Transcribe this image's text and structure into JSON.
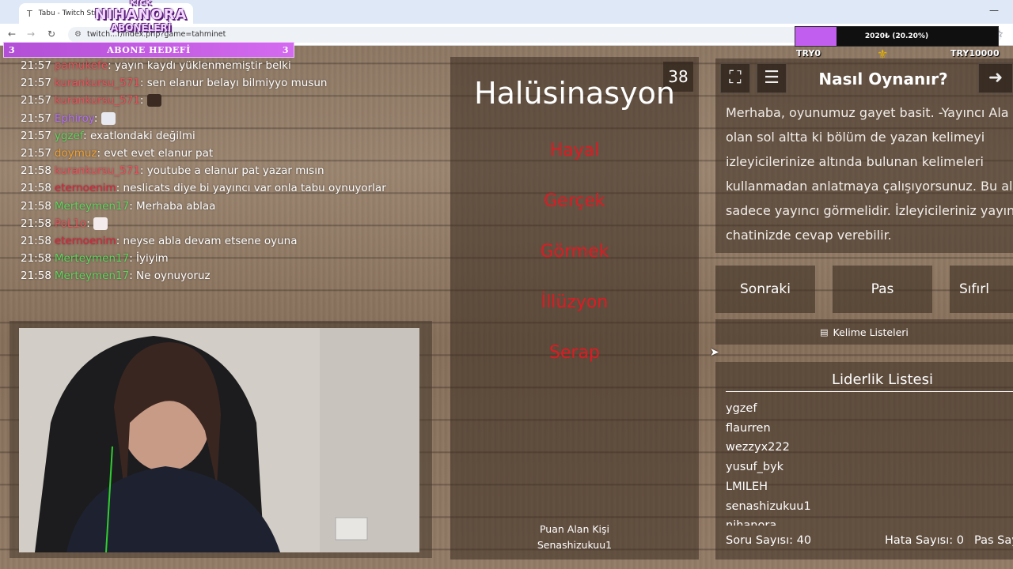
{
  "browser": {
    "tab_title": "Tabu - Twitch Strea",
    "tab_icon": "twitch-tools-icon",
    "url": "twitch...r/index.php?game=tahminet"
  },
  "overlay": {
    "logo_small": "KICK",
    "logo_big": "NIHANORA",
    "logo_mid": "ABONELERİ",
    "sub_goal": {
      "left_count": "3",
      "label": "ABONE HEDEFİ",
      "right_count": "3",
      "color": "#c15ef0"
    },
    "donation": {
      "text": "2020₺ (20.20%)",
      "progress": 0.202,
      "min_label": "TRY0",
      "max_label": "TRY10000",
      "fill_color": "#c15ef0"
    }
  },
  "chat": [
    {
      "time": "21:57",
      "user": "pamukefe",
      "color": "#e8505b",
      "message": "yayın kaydı yüklenmemiştir belki"
    },
    {
      "time": "21:57",
      "user": "kurankursu_571",
      "color": "#e8505b",
      "message": "sen elanur belayı bilmiyyo musun"
    },
    {
      "time": "21:57",
      "user": "kurankursu_571",
      "color": "#e8505b",
      "message": "",
      "emote": "#3a2a22"
    },
    {
      "time": "21:57",
      "user": "Ephiroy",
      "color": "#b06ef5",
      "message": "",
      "emote": "#e8e8f0"
    },
    {
      "time": "21:57",
      "user": "ygzef",
      "color": "#5cd65c",
      "message": "exatlondaki değilmi"
    },
    {
      "time": "21:57",
      "user": "doymuz",
      "color": "#f0a030",
      "message": "evet evet elanur pat"
    },
    {
      "time": "21:58",
      "user": "kurankursu_571",
      "color": "#e8505b",
      "message": "youtube a elanur pat yazar mısın"
    },
    {
      "time": "21:58",
      "user": "eternoenim",
      "color": "#e0203a",
      "message": "neslicats diye bi yayıncı var onla tabu oynuyorlar"
    },
    {
      "time": "21:58",
      "user": "Merteymen17",
      "color": "#5cd65c",
      "message": "Merhaba ablaa"
    },
    {
      "time": "21:58",
      "user": "PoL1o",
      "color": "#e8505b",
      "message": "",
      "emote": "#f4ecec"
    },
    {
      "time": "21:58",
      "user": "eternoenim",
      "color": "#e0203a",
      "message": "neyse abla devam etsene oyuna"
    },
    {
      "time": "21:58",
      "user": "Merteymen17",
      "color": "#5cd65c",
      "message": "İyiyim"
    },
    {
      "time": "21:58",
      "user": "Merteymen17",
      "color": "#5cd65c",
      "message": "Ne oynuyoruz"
    }
  ],
  "card": {
    "count": "38",
    "word": "Halüsinasyon",
    "taboo_words": [
      "Hayal",
      "Gerçek",
      "Görmek",
      "İllüzyon",
      "Serap"
    ],
    "scorer_label": "Puan Alan Kişi",
    "scorer_name": "Senashizukuu1",
    "taboo_color": "#e01a22"
  },
  "info": {
    "title": "Nasıl Oynanır?",
    "text_lines": [
      "Merhaba, oyunumuz gayet basit. -Yayıncı Ala",
      "olan sol altta ki bölüm de yazan kelimeyi",
      "izleyicilerinize altında bulunan kelimeleri",
      "kullanmadan anlatmaya çalışıyorsunuz. Bu ala",
      "sadece yayıncı görmelidir. İzleyicileriniz yayın",
      "chatinizde cevap verebilir."
    ]
  },
  "controls": {
    "next": "Sonraki",
    "pass": "Pas",
    "reset": "Sıfırl",
    "word_lists": "Kelime Listeleri"
  },
  "leaderboard": {
    "title": "Liderlik Listesi",
    "entries": [
      "ygzef",
      "flaurren",
      "wezzyx222",
      "yusuf_byk",
      "LMILEH",
      "senashizukuu1",
      "nihanora"
    ]
  },
  "stats": {
    "questions_label": "Soru Sayısı:",
    "questions_value": "40",
    "errors_label": "Hata Sayısı:",
    "errors_value": "0",
    "pass_label": "Pas Say"
  }
}
